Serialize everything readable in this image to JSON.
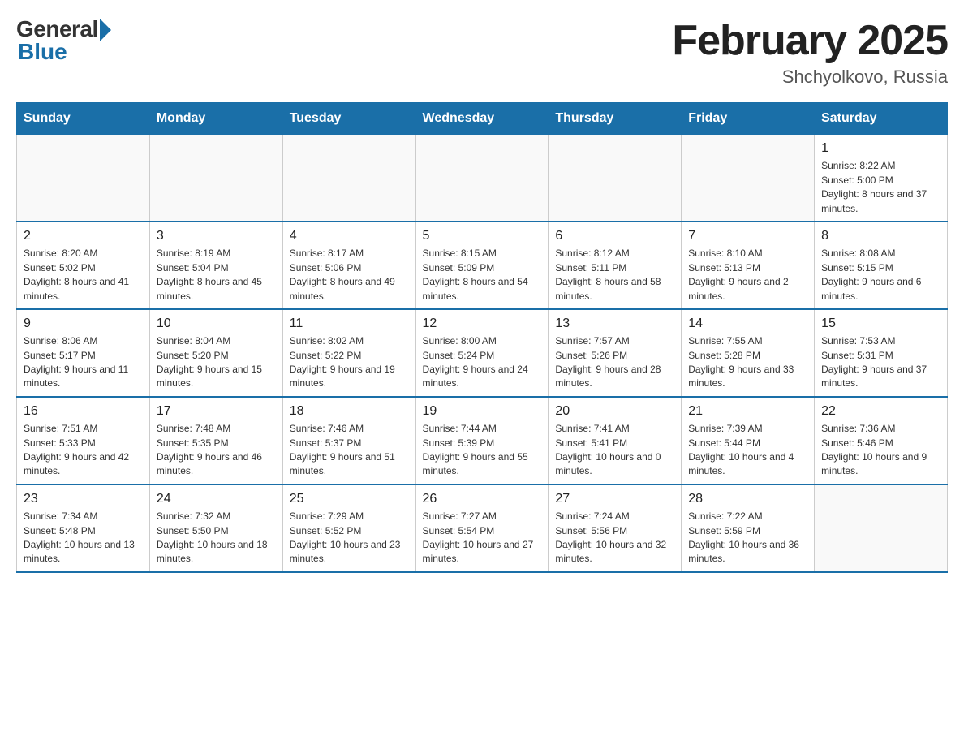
{
  "header": {
    "logo_general": "General",
    "logo_blue": "Blue",
    "title": "February 2025",
    "subtitle": "Shchyolkovo, Russia"
  },
  "days_of_week": [
    "Sunday",
    "Monday",
    "Tuesday",
    "Wednesday",
    "Thursday",
    "Friday",
    "Saturday"
  ],
  "weeks": [
    [
      {
        "day": "",
        "info": ""
      },
      {
        "day": "",
        "info": ""
      },
      {
        "day": "",
        "info": ""
      },
      {
        "day": "",
        "info": ""
      },
      {
        "day": "",
        "info": ""
      },
      {
        "day": "",
        "info": ""
      },
      {
        "day": "1",
        "info": "Sunrise: 8:22 AM\nSunset: 5:00 PM\nDaylight: 8 hours and 37 minutes."
      }
    ],
    [
      {
        "day": "2",
        "info": "Sunrise: 8:20 AM\nSunset: 5:02 PM\nDaylight: 8 hours and 41 minutes."
      },
      {
        "day": "3",
        "info": "Sunrise: 8:19 AM\nSunset: 5:04 PM\nDaylight: 8 hours and 45 minutes."
      },
      {
        "day": "4",
        "info": "Sunrise: 8:17 AM\nSunset: 5:06 PM\nDaylight: 8 hours and 49 minutes."
      },
      {
        "day": "5",
        "info": "Sunrise: 8:15 AM\nSunset: 5:09 PM\nDaylight: 8 hours and 54 minutes."
      },
      {
        "day": "6",
        "info": "Sunrise: 8:12 AM\nSunset: 5:11 PM\nDaylight: 8 hours and 58 minutes."
      },
      {
        "day": "7",
        "info": "Sunrise: 8:10 AM\nSunset: 5:13 PM\nDaylight: 9 hours and 2 minutes."
      },
      {
        "day": "8",
        "info": "Sunrise: 8:08 AM\nSunset: 5:15 PM\nDaylight: 9 hours and 6 minutes."
      }
    ],
    [
      {
        "day": "9",
        "info": "Sunrise: 8:06 AM\nSunset: 5:17 PM\nDaylight: 9 hours and 11 minutes."
      },
      {
        "day": "10",
        "info": "Sunrise: 8:04 AM\nSunset: 5:20 PM\nDaylight: 9 hours and 15 minutes."
      },
      {
        "day": "11",
        "info": "Sunrise: 8:02 AM\nSunset: 5:22 PM\nDaylight: 9 hours and 19 minutes."
      },
      {
        "day": "12",
        "info": "Sunrise: 8:00 AM\nSunset: 5:24 PM\nDaylight: 9 hours and 24 minutes."
      },
      {
        "day": "13",
        "info": "Sunrise: 7:57 AM\nSunset: 5:26 PM\nDaylight: 9 hours and 28 minutes."
      },
      {
        "day": "14",
        "info": "Sunrise: 7:55 AM\nSunset: 5:28 PM\nDaylight: 9 hours and 33 minutes."
      },
      {
        "day": "15",
        "info": "Sunrise: 7:53 AM\nSunset: 5:31 PM\nDaylight: 9 hours and 37 minutes."
      }
    ],
    [
      {
        "day": "16",
        "info": "Sunrise: 7:51 AM\nSunset: 5:33 PM\nDaylight: 9 hours and 42 minutes."
      },
      {
        "day": "17",
        "info": "Sunrise: 7:48 AM\nSunset: 5:35 PM\nDaylight: 9 hours and 46 minutes."
      },
      {
        "day": "18",
        "info": "Sunrise: 7:46 AM\nSunset: 5:37 PM\nDaylight: 9 hours and 51 minutes."
      },
      {
        "day": "19",
        "info": "Sunrise: 7:44 AM\nSunset: 5:39 PM\nDaylight: 9 hours and 55 minutes."
      },
      {
        "day": "20",
        "info": "Sunrise: 7:41 AM\nSunset: 5:41 PM\nDaylight: 10 hours and 0 minutes."
      },
      {
        "day": "21",
        "info": "Sunrise: 7:39 AM\nSunset: 5:44 PM\nDaylight: 10 hours and 4 minutes."
      },
      {
        "day": "22",
        "info": "Sunrise: 7:36 AM\nSunset: 5:46 PM\nDaylight: 10 hours and 9 minutes."
      }
    ],
    [
      {
        "day": "23",
        "info": "Sunrise: 7:34 AM\nSunset: 5:48 PM\nDaylight: 10 hours and 13 minutes."
      },
      {
        "day": "24",
        "info": "Sunrise: 7:32 AM\nSunset: 5:50 PM\nDaylight: 10 hours and 18 minutes."
      },
      {
        "day": "25",
        "info": "Sunrise: 7:29 AM\nSunset: 5:52 PM\nDaylight: 10 hours and 23 minutes."
      },
      {
        "day": "26",
        "info": "Sunrise: 7:27 AM\nSunset: 5:54 PM\nDaylight: 10 hours and 27 minutes."
      },
      {
        "day": "27",
        "info": "Sunrise: 7:24 AM\nSunset: 5:56 PM\nDaylight: 10 hours and 32 minutes."
      },
      {
        "day": "28",
        "info": "Sunrise: 7:22 AM\nSunset: 5:59 PM\nDaylight: 10 hours and 36 minutes."
      },
      {
        "day": "",
        "info": ""
      }
    ]
  ]
}
